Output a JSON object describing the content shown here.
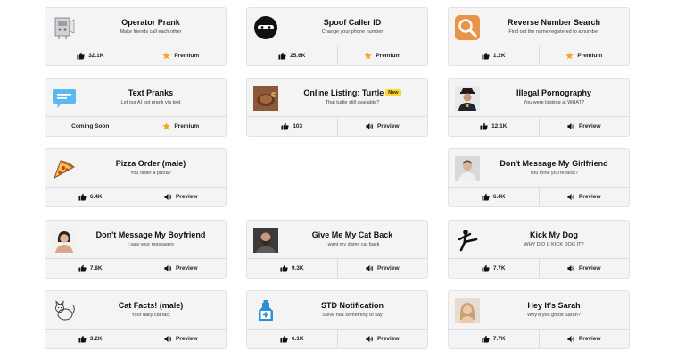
{
  "cards": [
    {
      "title": "Operator Prank",
      "subtitle": "Make friends call each other",
      "left": "32.1K",
      "right": "Premium",
      "left_icon": "thumbs-up-icon",
      "right_icon": "star-icon",
      "thumb": "operator-robot-image"
    },
    {
      "title": "Spoof Caller ID",
      "subtitle": "Change your phone number",
      "left": "25.6K",
      "right": "Premium",
      "left_icon": "thumbs-up-icon",
      "right_icon": "star-icon",
      "thumb": "masked-face-icon"
    },
    {
      "title": "Reverse Number Search",
      "subtitle": "Find out the name registered to a number",
      "left": "1.2K",
      "right": "Premium",
      "left_icon": "thumbs-up-icon",
      "right_icon": "star-icon",
      "thumb": "magnifier-icon"
    },
    {
      "title": "Text Pranks",
      "subtitle": "Let our AI bot prank via text",
      "left": "Coming Soon",
      "right": "Premium",
      "left_icon": "",
      "right_icon": "star-icon",
      "thumb": "chat-bubble-icon"
    },
    {
      "title": "Online Listing: Turtle",
      "badge": "New",
      "subtitle": "That turtle still available?",
      "left": "103",
      "right": "Preview",
      "left_icon": "thumbs-up-icon",
      "right_icon": "speaker-icon",
      "thumb": "turtle-image"
    },
    {
      "title": "Illegal Pornography",
      "subtitle": "You were looking at WHAT?",
      "left": "12.1K",
      "right": "Preview",
      "left_icon": "thumbs-up-icon",
      "right_icon": "speaker-icon",
      "thumb": "police-officer-image"
    },
    {
      "title": "Pizza Order (male)",
      "subtitle": "You order a pizza?",
      "left": "6.4K",
      "right": "Preview",
      "left_icon": "thumbs-up-icon",
      "right_icon": "speaker-icon",
      "thumb": "pizza-slice-icon"
    },
    {
      "title": "Don't Message My Girlfriend",
      "subtitle": "You think you're slick?",
      "left": "6.4K",
      "right": "Preview",
      "left_icon": "thumbs-up-icon",
      "right_icon": "speaker-icon",
      "thumb": "man-portrait-image"
    },
    {
      "title": "Don't Message My Boyfriend",
      "subtitle": "I saw your messages",
      "left": "7.8K",
      "right": "Preview",
      "left_icon": "thumbs-up-icon",
      "right_icon": "speaker-icon",
      "thumb": "woman-portrait-image"
    },
    {
      "title": "Give Me My Cat Back",
      "subtitle": "I want my damn cat back",
      "left": "9.3K",
      "right": "Preview",
      "left_icon": "thumbs-up-icon",
      "right_icon": "speaker-icon",
      "thumb": "bearded-man-image"
    },
    {
      "title": "Kick My Dog",
      "subtitle": "WHY DID U KICK DOG IT?",
      "left": "7.7K",
      "right": "Preview",
      "left_icon": "thumbs-up-icon",
      "right_icon": "speaker-icon",
      "thumb": "kicking-figure-icon"
    },
    {
      "title": "Cat Facts! (male)",
      "subtitle": "Your daily cat fact",
      "left": "3.2K",
      "right": "Preview",
      "left_icon": "thumbs-up-icon",
      "right_icon": "speaker-icon",
      "thumb": "cat-sketch-icon"
    },
    {
      "title": "STD Notification",
      "subtitle": "Steve has something to say",
      "left": "6.1K",
      "right": "Preview",
      "left_icon": "thumbs-up-icon",
      "right_icon": "speaker-icon",
      "thumb": "medical-flask-icon"
    },
    {
      "title": "Hey It's Sarah",
      "subtitle": "Why'd you ghost Sarah?",
      "left": "7.7K",
      "right": "Preview",
      "left_icon": "thumbs-up-icon",
      "right_icon": "speaker-icon",
      "thumb": "sarah-portrait-image"
    }
  ],
  "colors": {
    "card_bg": "#f4f4f5",
    "star": "#f5a623",
    "badge": "#ffd62e"
  }
}
